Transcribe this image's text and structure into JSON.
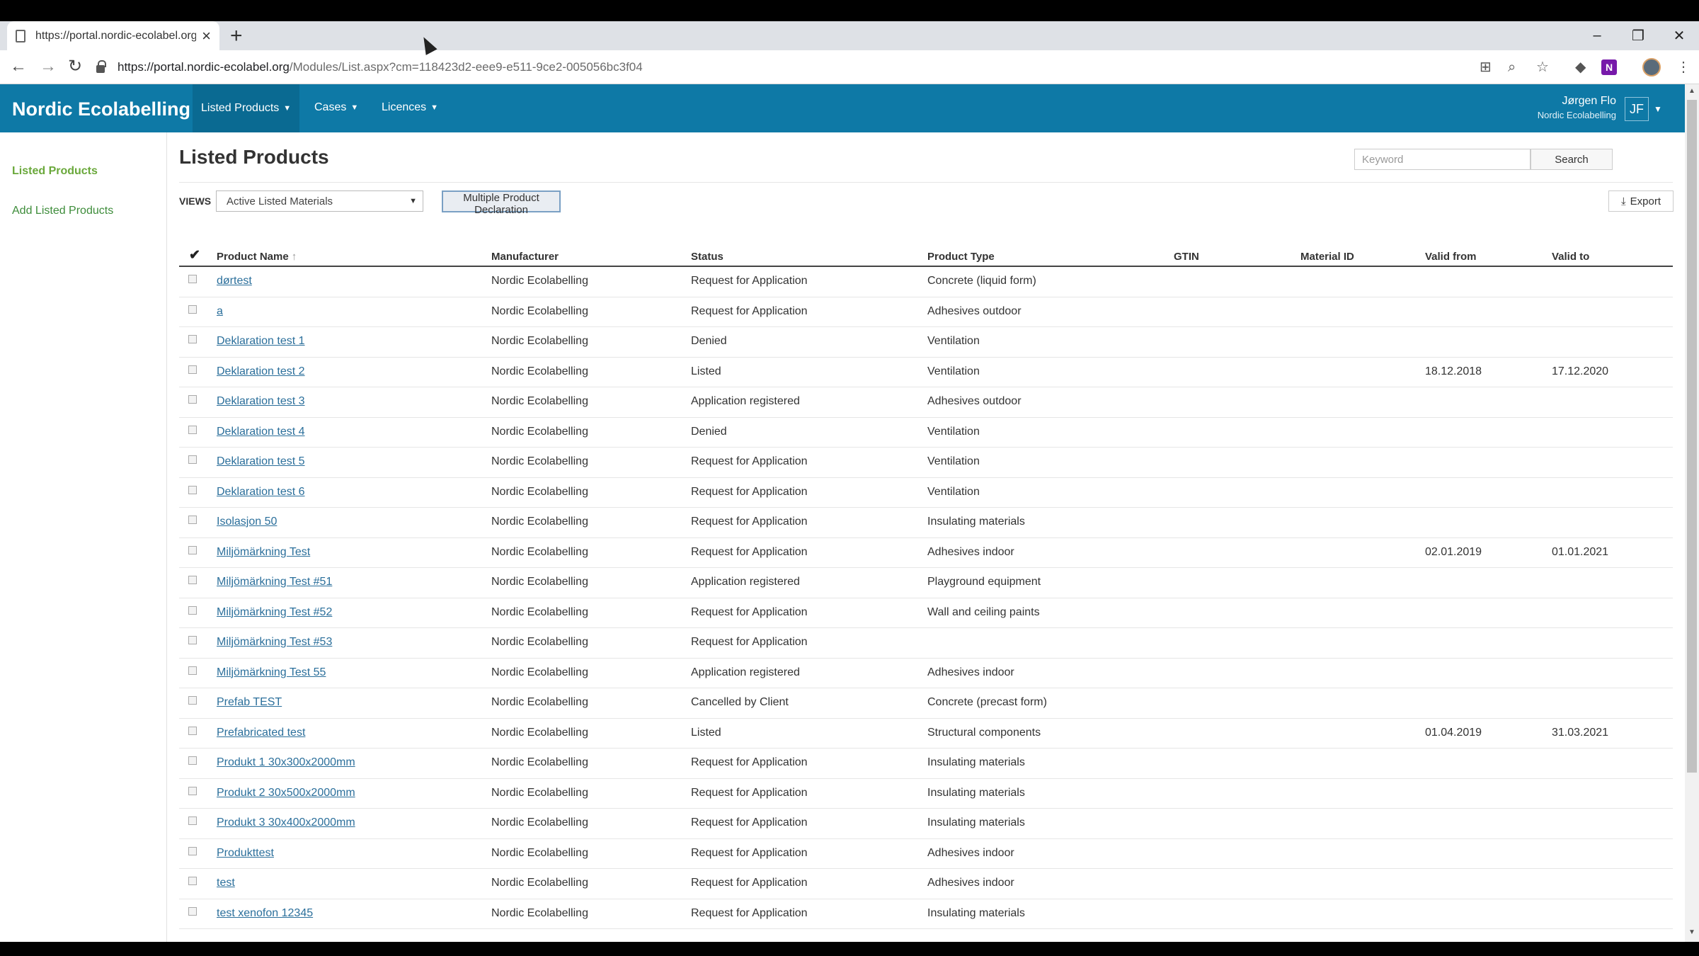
{
  "browser": {
    "tab_title": "https://portal.nordic-ecolabel.org",
    "url_host": "https://portal.nordic-ecolabel.org",
    "url_path": "/Modules/List.aspx?cm=118423d2-eee9-e511-9ce2-005056bc3f04"
  },
  "app": {
    "brand": "Nordic Ecolabelling",
    "nav": [
      "Listed Products",
      "Cases",
      "Licences"
    ],
    "user_name": "Jørgen Flo",
    "user_org": "Nordic Ecolabelling",
    "user_initials": "JF"
  },
  "sidebar": {
    "items": [
      {
        "label": "Listed Products"
      },
      {
        "label": "Add Listed Products"
      }
    ]
  },
  "page": {
    "title": "Listed Products",
    "search_placeholder": "Keyword",
    "search_button": "Search",
    "views_label": "VIEWS",
    "views_selected": "Active Listed Materials",
    "mpd_button": "Multiple Product Declaration",
    "export_button": "Export"
  },
  "table": {
    "columns": [
      "Product Name",
      "Manufacturer",
      "Status",
      "Product Type",
      "GTIN",
      "Material ID",
      "Valid from",
      "Valid to"
    ],
    "sort_column": "Product Name",
    "rows": [
      {
        "name": "dørtest",
        "manufacturer": "Nordic Ecolabelling",
        "status": "Request for Application",
        "type": "Concrete (liquid form)",
        "gtin": "",
        "material_id": "",
        "valid_from": "",
        "valid_to": ""
      },
      {
        "name": "a",
        "manufacturer": "Nordic Ecolabelling",
        "status": "Request for Application",
        "type": "Adhesives outdoor",
        "gtin": "",
        "material_id": "",
        "valid_from": "",
        "valid_to": ""
      },
      {
        "name": "Deklaration test 1",
        "manufacturer": "Nordic Ecolabelling",
        "status": "Denied",
        "type": "Ventilation",
        "gtin": "",
        "material_id": "",
        "valid_from": "",
        "valid_to": ""
      },
      {
        "name": "Deklaration test 2",
        "manufacturer": "Nordic Ecolabelling",
        "status": "Listed",
        "type": "Ventilation",
        "gtin": "",
        "material_id": "",
        "valid_from": "18.12.2018",
        "valid_to": "17.12.2020"
      },
      {
        "name": "Deklaration test 3",
        "manufacturer": "Nordic Ecolabelling",
        "status": "Application registered",
        "type": "Adhesives outdoor",
        "gtin": "",
        "material_id": "",
        "valid_from": "",
        "valid_to": ""
      },
      {
        "name": "Deklaration test 4",
        "manufacturer": "Nordic Ecolabelling",
        "status": "Denied",
        "type": "Ventilation",
        "gtin": "",
        "material_id": "",
        "valid_from": "",
        "valid_to": ""
      },
      {
        "name": "Deklaration test 5",
        "manufacturer": "Nordic Ecolabelling",
        "status": "Request for Application",
        "type": "Ventilation",
        "gtin": "",
        "material_id": "",
        "valid_from": "",
        "valid_to": ""
      },
      {
        "name": "Deklaration test 6",
        "manufacturer": "Nordic Ecolabelling",
        "status": "Request for Application",
        "type": "Ventilation",
        "gtin": "",
        "material_id": "",
        "valid_from": "",
        "valid_to": ""
      },
      {
        "name": "Isolasjon 50",
        "manufacturer": "Nordic Ecolabelling",
        "status": "Request for Application",
        "type": "Insulating materials",
        "gtin": "",
        "material_id": "",
        "valid_from": "",
        "valid_to": ""
      },
      {
        "name": "Miljömärkning Test",
        "manufacturer": "Nordic Ecolabelling",
        "status": "Request for Application",
        "type": "Adhesives indoor",
        "gtin": "",
        "material_id": "",
        "valid_from": "02.01.2019",
        "valid_to": "01.01.2021"
      },
      {
        "name": "Miljömärkning Test #51",
        "manufacturer": "Nordic Ecolabelling",
        "status": "Application registered",
        "type": "Playground equipment",
        "gtin": "",
        "material_id": "",
        "valid_from": "",
        "valid_to": ""
      },
      {
        "name": "Miljömärkning Test #52",
        "manufacturer": "Nordic Ecolabelling",
        "status": "Request for Application",
        "type": "Wall and ceiling paints",
        "gtin": "",
        "material_id": "",
        "valid_from": "",
        "valid_to": ""
      },
      {
        "name": "Miljömärkning Test #53",
        "manufacturer": "Nordic Ecolabelling",
        "status": "Request for Application",
        "type": "",
        "gtin": "",
        "material_id": "",
        "valid_from": "",
        "valid_to": ""
      },
      {
        "name": "Miljömärkning Test 55",
        "manufacturer": "Nordic Ecolabelling",
        "status": "Application registered",
        "type": "Adhesives indoor",
        "gtin": "",
        "material_id": "",
        "valid_from": "",
        "valid_to": ""
      },
      {
        "name": "Prefab TEST",
        "manufacturer": "Nordic Ecolabelling",
        "status": "Cancelled by Client",
        "type": "Concrete (precast form)",
        "gtin": "",
        "material_id": "",
        "valid_from": "",
        "valid_to": ""
      },
      {
        "name": "Prefabricated test",
        "manufacturer": "Nordic Ecolabelling",
        "status": "Listed",
        "type": "Structural components",
        "gtin": "",
        "material_id": "",
        "valid_from": "01.04.2019",
        "valid_to": "31.03.2021"
      },
      {
        "name": "Produkt 1 30x300x2000mm",
        "manufacturer": "Nordic Ecolabelling",
        "status": "Request for Application",
        "type": "Insulating materials",
        "gtin": "",
        "material_id": "",
        "valid_from": "",
        "valid_to": ""
      },
      {
        "name": "Produkt 2 30x500x2000mm",
        "manufacturer": "Nordic Ecolabelling",
        "status": "Request for Application",
        "type": "Insulating materials",
        "gtin": "",
        "material_id": "",
        "valid_from": "",
        "valid_to": ""
      },
      {
        "name": "Produkt 3 30x400x2000mm",
        "manufacturer": "Nordic Ecolabelling",
        "status": "Request for Application",
        "type": "Insulating materials",
        "gtin": "",
        "material_id": "",
        "valid_from": "",
        "valid_to": ""
      },
      {
        "name": "Produkttest",
        "manufacturer": "Nordic Ecolabelling",
        "status": "Request for Application",
        "type": "Adhesives indoor",
        "gtin": "",
        "material_id": "",
        "valid_from": "",
        "valid_to": ""
      },
      {
        "name": "test",
        "manufacturer": "Nordic Ecolabelling",
        "status": "Request for Application",
        "type": "Adhesives indoor",
        "gtin": "",
        "material_id": "",
        "valid_from": "",
        "valid_to": ""
      },
      {
        "name": "test xenofon 12345",
        "manufacturer": "Nordic Ecolabelling",
        "status": "Request for Application",
        "type": "Insulating materials",
        "gtin": "",
        "material_id": "",
        "valid_from": "",
        "valid_to": ""
      }
    ]
  },
  "colors": {
    "header_bg": "#0e79a6",
    "link": "#2b6f9b",
    "sidebar_active": "#6aa83b"
  },
  "icons": [
    "document-icon",
    "close-icon",
    "plus-icon",
    "back-icon",
    "forward-icon",
    "reload-icon",
    "lock-icon",
    "translate-icon",
    "zoom-icon",
    "star-icon",
    "extension-icon",
    "onenote-icon",
    "profile-icon",
    "menu-icon",
    "checkmark-icon",
    "sort-ascending-icon",
    "download-icon",
    "chevron-down-icon"
  ]
}
